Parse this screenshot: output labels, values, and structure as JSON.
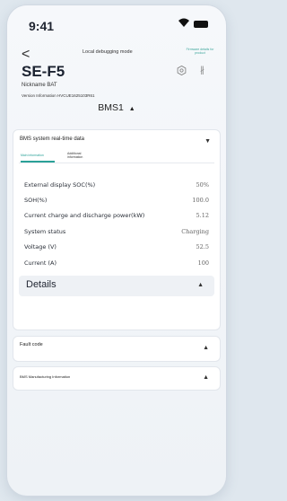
{
  "status_bar": {
    "time": "9:41"
  },
  "header": {
    "back_label": "<",
    "mode_label": "Local debugging mode",
    "top_right_link": "Firmware details for product",
    "model": "SE-F5",
    "nickname": "Nickname BAT",
    "version": "Version Information HVCUE1625103R61",
    "selected_bms": "BMS1",
    "bms_caret": "▲"
  },
  "bms_card": {
    "title": "BMS system real-time data",
    "toggle_icon": "▼",
    "tabs": [
      {
        "label": "Main information"
      },
      {
        "label": "Additional information"
      }
    ],
    "rows": [
      {
        "label": "External display SOC(%)",
        "value": "50%"
      },
      {
        "label": "SOH(%)",
        "value": "100.0"
      },
      {
        "label": "Current charge and discharge power(kW)",
        "value": "5.12"
      },
      {
        "label": "System status",
        "value": "Charging"
      },
      {
        "label": "Voltage (V)",
        "value": "52.5"
      },
      {
        "label": "Current (A)",
        "value": "100"
      }
    ],
    "details": {
      "label": "Details",
      "toggle_icon": "▲"
    }
  },
  "fault_card": {
    "title": "Fault code",
    "toggle_icon": "▲"
  },
  "manufacturing_card": {
    "title": "BMS Manufacturing Information",
    "toggle_icon": "▲"
  },
  "colors": {
    "accent": "#2aa198",
    "background": "#eef2f6",
    "card": "#ffffff"
  },
  "icons": {
    "signal": "wifi-icon",
    "battery": "battery-icon",
    "settings": "gear-icon",
    "bluetooth": "bluetooth-icon"
  }
}
